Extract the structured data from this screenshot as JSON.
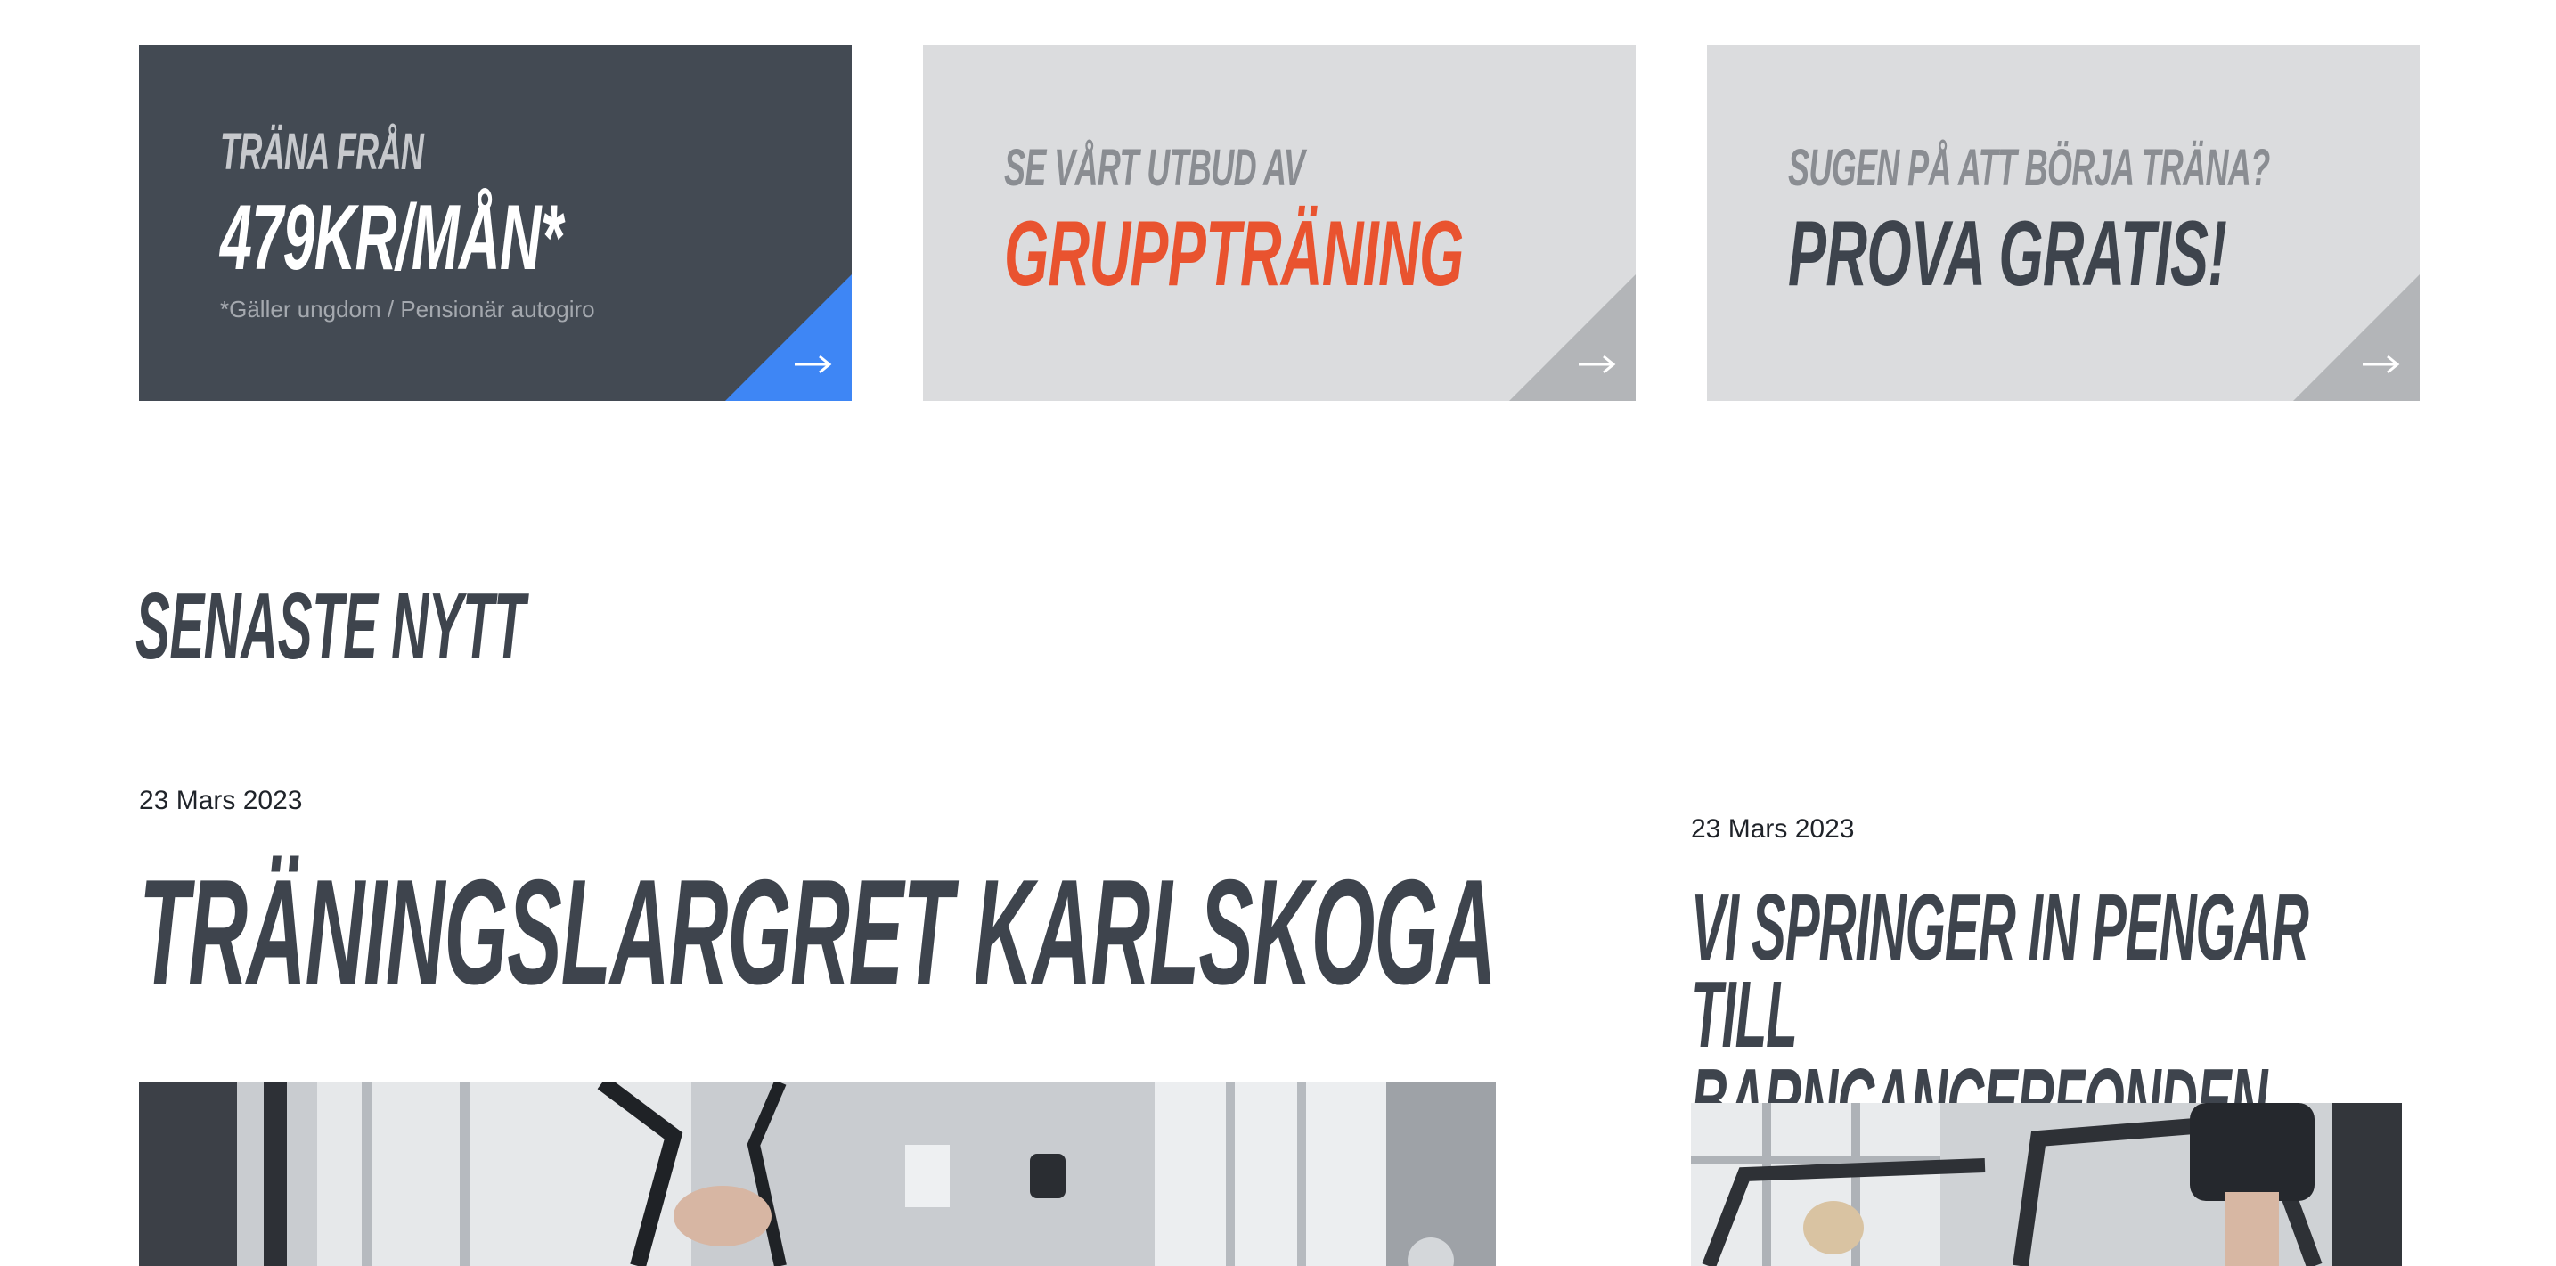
{
  "promos": [
    {
      "kicker": "TRÄNA FRÅN",
      "headline": "479KR/MÅN*",
      "note": "*Gäller ungdom / Pensionär autogiro",
      "background": "#434a53",
      "corner_color": "#3e86f5",
      "icon": "arrow-right-icon"
    },
    {
      "kicker": "SE VÅRT UTBUD AV",
      "headline": "GRUPPTRÄNING",
      "background": "#dbdcde",
      "headline_color": "#e9532f",
      "corner_color": "#b3b5b8",
      "icon": "arrow-right-icon"
    },
    {
      "kicker": "SUGEN PÅ ATT BÖRJA TRÄNA?",
      "headline": "PROVA GRATIS!",
      "background": "#dbdcde",
      "corner_color": "#b3b5b8",
      "icon": "arrow-right-icon"
    }
  ],
  "news": {
    "section_title": "SENASTE NYTT",
    "articles": [
      {
        "date": "23 Mars 2023",
        "title": "TRÄNINGSLARGRET KARLSKOGA"
      },
      {
        "date": "23 Mars 2023",
        "title": "VI SPRINGER IN PENGAR TILL BARNCANCERFONDEN"
      }
    ]
  },
  "colors": {
    "text": "#3e444d",
    "accent_orange": "#e9532f",
    "accent_blue": "#3e86f5"
  }
}
